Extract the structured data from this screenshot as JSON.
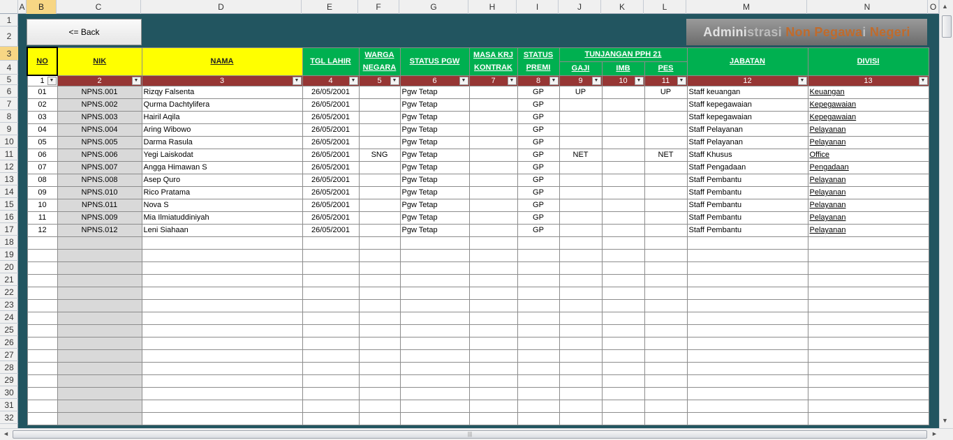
{
  "columns": [
    "A",
    "B",
    "C",
    "D",
    "E",
    "F",
    "G",
    "H",
    "I",
    "J",
    "K",
    "L",
    "M",
    "N",
    "O"
  ],
  "rows": [
    "1",
    "2",
    "3",
    "4",
    "5",
    "6",
    "7",
    "8",
    "9",
    "10",
    "11",
    "12",
    "13",
    "14",
    "15",
    "16",
    "17",
    "18",
    "19",
    "20",
    "21",
    "22",
    "23",
    "24",
    "25",
    "26",
    "27",
    "28",
    "29",
    "30",
    "31",
    "32"
  ],
  "back_button": "<= Back",
  "title": {
    "part1": "Admini",
    "part2": "strasi ",
    "part3": "Non Pegawa",
    "part4": "i ",
    "part5": "Negeri"
  },
  "headers": {
    "no": "NO",
    "nik": "NIK",
    "nama": "NAMA",
    "tgl_lahir": "TGL LAHIR",
    "warga_negara": "WARGA NEGARA",
    "status_pgw": "STATUS PGW",
    "masa_krj_kontrak": "MASA KRJ KONTRAK",
    "status_premi": "STATUS PREMI",
    "tunjangan": "TUNJANGAN PPH 21",
    "gaji": "GAJI",
    "imb": "IMB",
    "pes": "PES",
    "jabatan": "JABATAN",
    "divisi": "DIVISI"
  },
  "column_numbers": [
    "1",
    "2",
    "3",
    "4",
    "5",
    "6",
    "7",
    "8",
    "9",
    "10",
    "11",
    "12",
    "13"
  ],
  "filter_icon": "▼",
  "records": [
    {
      "no": "01",
      "nik": "NPNS.001",
      "nama": "Rizqy Falsenta",
      "tgl": "26/05/2001",
      "warga": "",
      "status": "Pgw Tetap",
      "masa": "",
      "premi": "GP",
      "gaji": "UP",
      "imb": "",
      "pes": "UP",
      "jabatan": "Staff keuangan",
      "divisi": "Keuangan"
    },
    {
      "no": "02",
      "nik": "NPNS.002",
      "nama": "Qurma Dachtylifera",
      "tgl": "26/05/2001",
      "warga": "",
      "status": "Pgw Tetap",
      "masa": "",
      "premi": "GP",
      "gaji": "",
      "imb": "",
      "pes": "",
      "jabatan": "Staff kepegawaian",
      "divisi": "Kepegawaian"
    },
    {
      "no": "03",
      "nik": "NPNS.003",
      "nama": "Hairil Aqila",
      "tgl": "26/05/2001",
      "warga": "",
      "status": "Pgw Tetap",
      "masa": "",
      "premi": "GP",
      "gaji": "",
      "imb": "",
      "pes": "",
      "jabatan": "Staff kepegawaian",
      "divisi": "Kepegawaian"
    },
    {
      "no": "04",
      "nik": "NPNS.004",
      "nama": "Aring Wibowo",
      "tgl": "26/05/2001",
      "warga": "",
      "status": "Pgw Tetap",
      "masa": "",
      "premi": "GP",
      "gaji": "",
      "imb": "",
      "pes": "",
      "jabatan": "Staff Pelayanan",
      "divisi": "Pelayanan"
    },
    {
      "no": "05",
      "nik": "NPNS.005",
      "nama": "Darma Rasula",
      "tgl": "26/05/2001",
      "warga": "",
      "status": "Pgw Tetap",
      "masa": "",
      "premi": "GP",
      "gaji": "",
      "imb": "",
      "pes": "",
      "jabatan": "Staff Pelayanan",
      "divisi": "Pelayanan"
    },
    {
      "no": "06",
      "nik": "NPNS.006",
      "nama": "Yegi Laiskodat",
      "tgl": "26/05/2001",
      "warga": "SNG",
      "status": "Pgw Tetap",
      "masa": "",
      "premi": "GP",
      "gaji": "NET",
      "imb": "",
      "pes": "NET",
      "jabatan": "Staff Khusus",
      "divisi": "Office"
    },
    {
      "no": "07",
      "nik": "NPNS.007",
      "nama": "Angga Himawan S",
      "tgl": "26/05/2001",
      "warga": "",
      "status": "Pgw Tetap",
      "masa": "",
      "premi": "GP",
      "gaji": "",
      "imb": "",
      "pes": "",
      "jabatan": "Staff Pengadaan",
      "divisi": "Pengadaan"
    },
    {
      "no": "08",
      "nik": "NPNS.008",
      "nama": "Asep Quro",
      "tgl": "26/05/2001",
      "warga": "",
      "status": "Pgw Tetap",
      "masa": "",
      "premi": "GP",
      "gaji": "",
      "imb": "",
      "pes": "",
      "jabatan": "Staff Pembantu",
      "divisi": "Pelayanan"
    },
    {
      "no": "09",
      "nik": "NPNS.010",
      "nama": "Rico Pratama",
      "tgl": "26/05/2001",
      "warga": "",
      "status": "Pgw Tetap",
      "masa": "",
      "premi": "GP",
      "gaji": "",
      "imb": "",
      "pes": "",
      "jabatan": "Staff Pembantu",
      "divisi": "Pelayanan"
    },
    {
      "no": "10",
      "nik": "NPNS.011",
      "nama": "Nova S",
      "tgl": "26/05/2001",
      "warga": "",
      "status": "Pgw Tetap",
      "masa": "",
      "premi": "GP",
      "gaji": "",
      "imb": "",
      "pes": "",
      "jabatan": "Staff Pembantu",
      "divisi": "Pelayanan"
    },
    {
      "no": "11",
      "nik": "NPNS.009",
      "nama": "Mia Ilmiatuddiniyah",
      "tgl": "26/05/2001",
      "warga": "",
      "status": "Pgw Tetap",
      "masa": "",
      "premi": "GP",
      "gaji": "",
      "imb": "",
      "pes": "",
      "jabatan": "Staff Pembantu",
      "divisi": "Pelayanan"
    },
    {
      "no": "12",
      "nik": "NPNS.012",
      "nama": "Leni Siahaan",
      "tgl": "26/05/2001",
      "warga": "",
      "status": "Pgw Tetap",
      "masa": "",
      "premi": "GP",
      "gaji": "",
      "imb": "",
      "pes": "",
      "jabatan": "Staff Pembantu",
      "divisi": "Pelayanan"
    }
  ],
  "empty_row_count": 15,
  "scrollbar": {
    "up": "▲",
    "down": "▼",
    "left": "◄",
    "right": "►",
    "grip": "|||"
  },
  "colors": {
    "sheet_bg": "#225560",
    "yellow_header": "#ffff00",
    "green_header": "#00b050",
    "number_row": "#963634",
    "gray_cell": "#d9d9d9"
  }
}
